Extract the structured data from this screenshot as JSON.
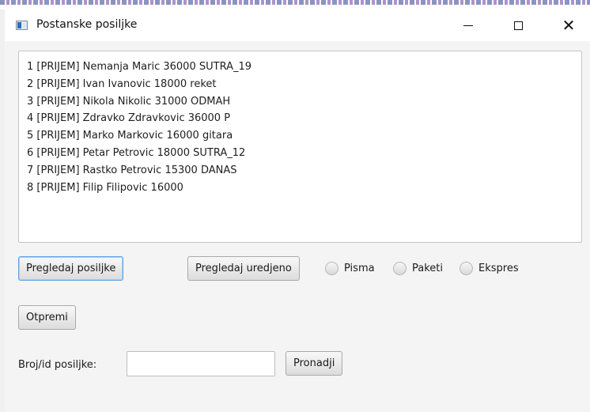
{
  "window": {
    "title": "Postanske posiljke",
    "controls": {
      "minimize": "minimize-icon",
      "maximize": "maximize-icon",
      "close": "close-icon"
    }
  },
  "output": {
    "lines": [
      "1 [PRIJEM] Nemanja Maric 36000 SUTRA_19",
      "2 [PRIJEM] Ivan Ivanovic 18000 reket",
      "3 [PRIJEM] Nikola Nikolic 31000 ODMAH",
      "4 [PRIJEM] Zdravko Zdravkovic 36000 P",
      "5 [PRIJEM] Marko Markovic 16000 gitara",
      "6 [PRIJEM] Petar Petrovic 18000 SUTRA_12",
      "7 [PRIJEM] Rastko Petrovic 15300 DANAS",
      "8 [PRIJEM] Filip Filipovic 16000"
    ]
  },
  "buttons": {
    "pregledaj": "Pregledaj posiljke",
    "pregledaj_uredjeno": "Pregledaj uredjeno",
    "otpremi": "Otpremi",
    "pronadji": "Pronadji"
  },
  "radios": {
    "pisma": "Pisma",
    "paketi": "Paketi",
    "ekspres": "Ekspres"
  },
  "search": {
    "label": "Broj/id posiljke:",
    "value": "",
    "placeholder": ""
  },
  "colors": {
    "focus": "#5fa3e6",
    "window_bg": "#f4f4f4"
  }
}
